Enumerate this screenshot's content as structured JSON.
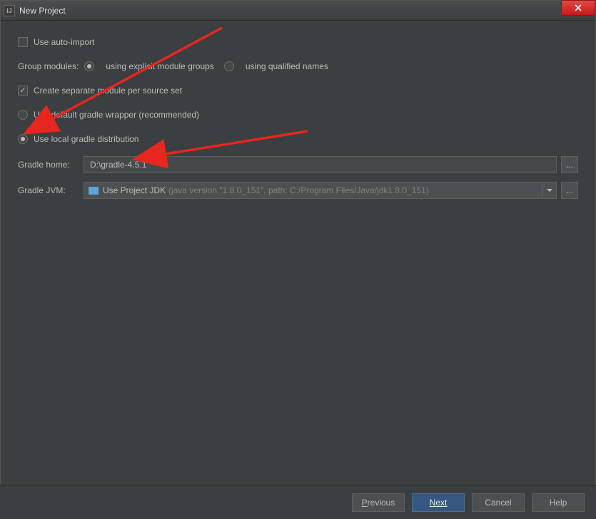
{
  "window": {
    "title": "New Project",
    "app_icon_label": "IJ"
  },
  "options": {
    "auto_import_label": "Use auto-import",
    "auto_import_checked": false,
    "group_modules_label": "Group modules:",
    "group_explicit_label": "using explicit module groups",
    "group_qualified_label": "using qualified names",
    "group_selected": "explicit",
    "create_separate_label": "Create separate module per source set",
    "create_separate_checked": true,
    "wrapper_default_label": "Use default gradle wrapper (recommended)",
    "wrapper_local_label": "Use local gradle distribution",
    "wrapper_selected": "local"
  },
  "fields": {
    "gradle_home_label": "Gradle home:",
    "gradle_home_value": "D:\\gradle-4.5.1",
    "gradle_jvm_label": "Gradle JVM:",
    "gradle_jvm_value": "Use Project JDK",
    "gradle_jvm_detail": "(java version \"1.8.0_151\", path: C:/Program Files/Java/jdk1.8.0_151)"
  },
  "buttons": {
    "previous": "Previous",
    "next": "Next",
    "cancel": "Cancel",
    "help": "Help",
    "ellipsis": "..."
  }
}
